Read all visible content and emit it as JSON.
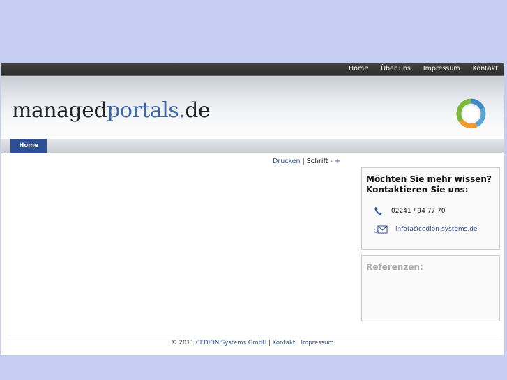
{
  "topnav": {
    "items": [
      "Home",
      "Über uns",
      "Impressum",
      "Kontakt"
    ]
  },
  "logo": {
    "part1": "managed",
    "part2": "portals.",
    "part3": "de"
  },
  "subnav": {
    "home": "Home"
  },
  "toolbar": {
    "print": "Drucken",
    "sep": " | ",
    "font_label": "Schrift",
    "minus": "-",
    "plus": "+"
  },
  "contact": {
    "title": "Möchten Sie mehr wissen? Kontaktieren Sie uns:",
    "phone": "02241 / 94 77 70",
    "email": "info(at)cedion-systems.de",
    "phone_icon": "phone-icon",
    "mail_icon": "mail-icon"
  },
  "references": {
    "title": "Referenzen:"
  },
  "footer": {
    "copyright": "© 2011",
    "company": "CEDION Systems GmbH",
    "sep1": " | ",
    "contact": "Kontakt",
    "sep2": " | ",
    "imprint": "Impressum"
  },
  "colors": {
    "background": "#c5cdf1",
    "accent": "#2d4f95",
    "topbar": "#333333"
  }
}
